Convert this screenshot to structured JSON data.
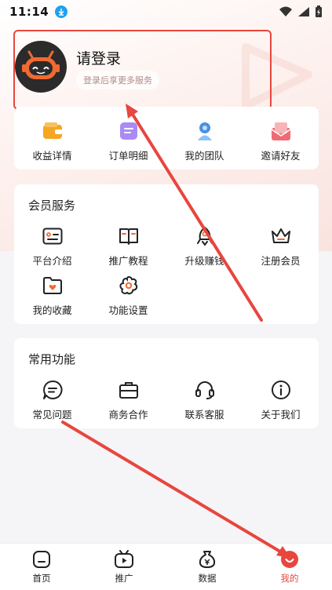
{
  "status_bar": {
    "time": "11:14",
    "download_icon": "download-icon",
    "wifi_icon": "wifi-icon",
    "signal_icon": "signal-icon",
    "battery_icon": "battery-charging-icon"
  },
  "profile": {
    "title": "请登录",
    "subtitle": "登录后享更多服务"
  },
  "quick_actions": [
    {
      "label": "收益详情",
      "icon": "wallet-icon",
      "color": "#f5a623"
    },
    {
      "label": "订单明细",
      "icon": "order-list-icon",
      "color": "#a98bf5"
    },
    {
      "label": "我的团队",
      "icon": "team-icon",
      "color": "#4a90e2"
    },
    {
      "label": "邀请好友",
      "icon": "invite-envelope-icon",
      "color": "#f06b73"
    }
  ],
  "member_services": {
    "title": "会员服务",
    "items": [
      {
        "label": "平台介绍",
        "icon": "id-card-icon"
      },
      {
        "label": "推广教程",
        "icon": "book-icon"
      },
      {
        "label": "升级赚钱",
        "icon": "rocket-icon"
      },
      {
        "label": "注册会员",
        "icon": "crown-icon"
      },
      {
        "label": "我的收藏",
        "icon": "heart-folder-icon"
      },
      {
        "label": "功能设置",
        "icon": "gear-flower-icon"
      }
    ]
  },
  "common_functions": {
    "title": "常用功能",
    "items": [
      {
        "label": "常见问题",
        "icon": "chat-bubble-icon"
      },
      {
        "label": "商务合作",
        "icon": "briefcase-icon"
      },
      {
        "label": "联系客服",
        "icon": "headset-icon"
      },
      {
        "label": "关于我们",
        "icon": "info-icon"
      }
    ]
  },
  "bottom_nav": [
    {
      "label": "首页",
      "icon": "home-icon",
      "active": false
    },
    {
      "label": "推广",
      "icon": "tv-play-icon",
      "active": false
    },
    {
      "label": "数据",
      "icon": "money-bag-icon",
      "active": false
    },
    {
      "label": "我的",
      "icon": "profile-active-icon",
      "active": true
    }
  ],
  "colors": {
    "accent": "#e8463e",
    "icon_stroke": "#222222"
  }
}
